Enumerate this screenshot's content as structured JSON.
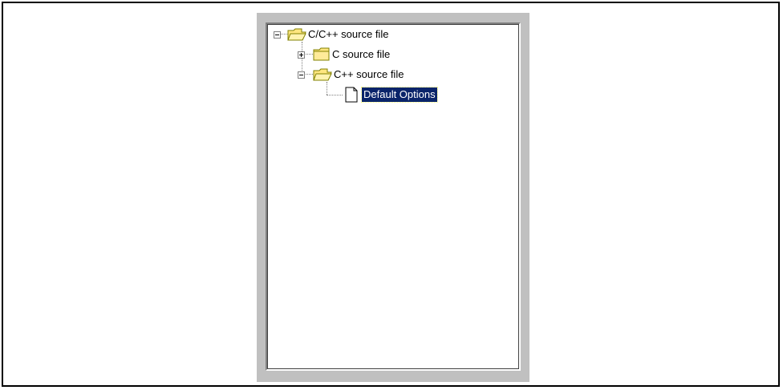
{
  "tree": {
    "root": {
      "label": "C/C++ source file",
      "expanded": true,
      "icon": "folder-open-icon"
    },
    "c_source": {
      "label": "C source file",
      "expanded": false,
      "icon": "folder-closed-icon"
    },
    "cpp_source": {
      "label": "C++ source file",
      "expanded": true,
      "icon": "folder-open-icon"
    },
    "default_options": {
      "label": "Default Options",
      "selected": true,
      "icon": "document-icon"
    }
  },
  "colors": {
    "selection": "#0a246a",
    "folder": "#ffe680",
    "panel": "#c0c0c0"
  }
}
